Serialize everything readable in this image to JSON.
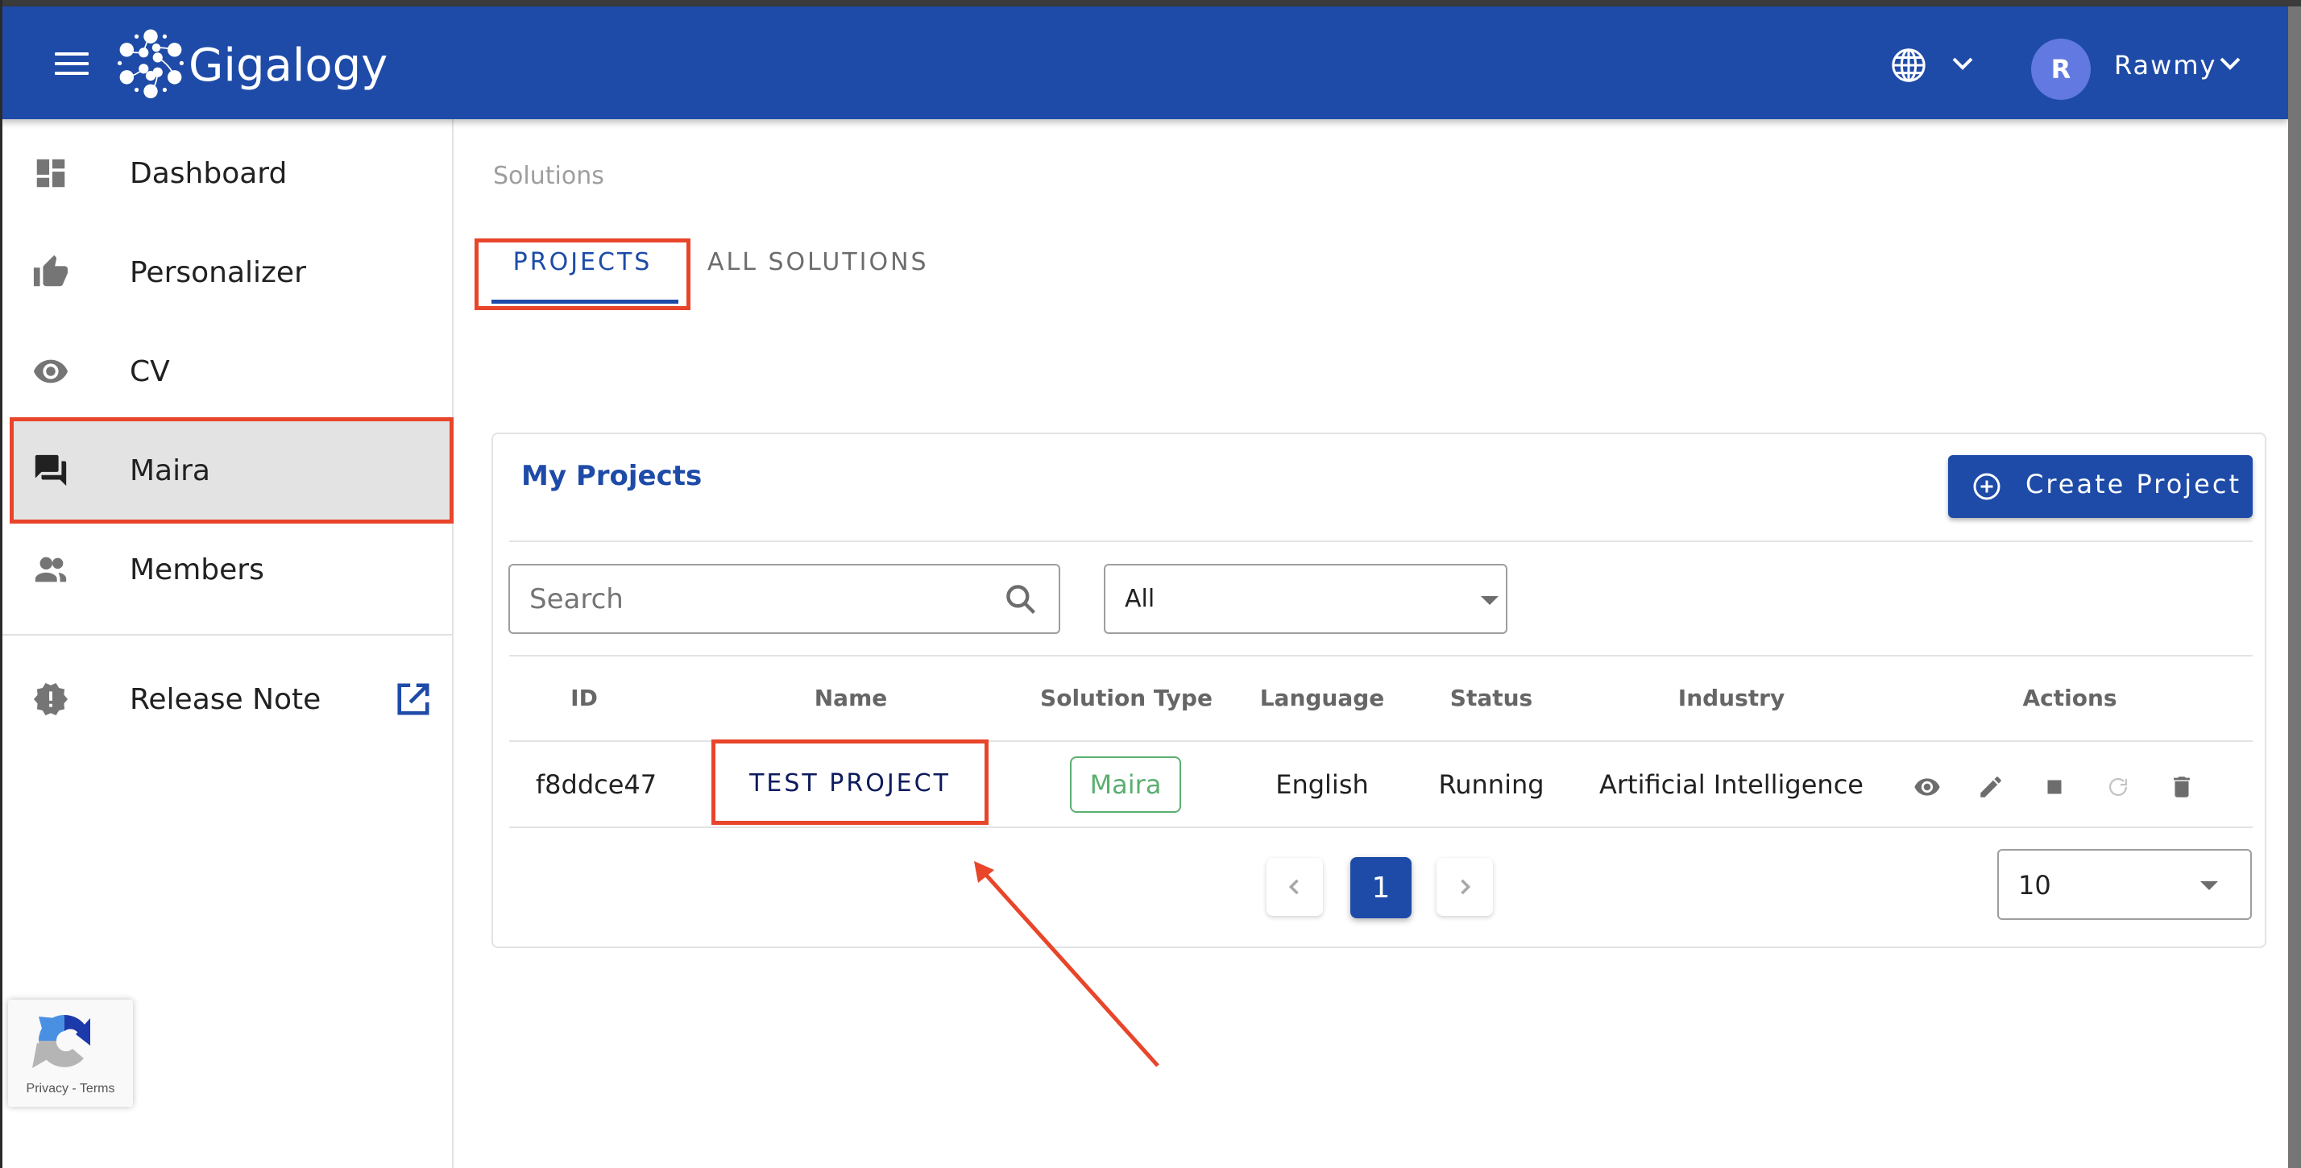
{
  "header": {
    "brand": "Gigalogy",
    "avatar_initial": "R",
    "username": "Rawmy",
    "brand_color": "#1e4ba8"
  },
  "sidebar": {
    "items": [
      {
        "label": "Dashboard",
        "icon": "dashboard-icon"
      },
      {
        "label": "Personalizer",
        "icon": "thumb-up-icon"
      },
      {
        "label": "CV",
        "icon": "eye-icon"
      },
      {
        "label": "Maira",
        "icon": "chat-icon",
        "active": true
      },
      {
        "label": "Members",
        "icon": "people-icon"
      }
    ],
    "release_note": {
      "label": "Release Note",
      "icon": "alert-badge-icon",
      "link_icon": "open-in-new-icon"
    }
  },
  "recaptcha": {
    "text": "Privacy - Terms"
  },
  "main": {
    "breadcrumb": "Solutions",
    "tabs": [
      {
        "label": "PROJECTS",
        "active": true
      },
      {
        "label": "ALL SOLUTIONS",
        "active": false
      }
    ],
    "card": {
      "title": "My Projects",
      "create_button": "Create Project",
      "search_placeholder": "Search",
      "filter_value": "All",
      "table": {
        "columns": [
          "ID",
          "Name",
          "Solution Type",
          "Language",
          "Status",
          "Industry",
          "Actions"
        ],
        "rows": [
          {
            "id": "f8ddce47",
            "name": "TEST PROJECT",
            "solution_type": "Maira",
            "language": "English",
            "status": "Running",
            "industry": "Artificial Intelligence",
            "actions": [
              "view-icon",
              "edit-icon",
              "stop-icon",
              "restart-icon",
              "delete-icon"
            ]
          }
        ]
      },
      "pagination": {
        "current_page": "1",
        "rows_per_page": "10"
      }
    }
  },
  "annotation_color": "#e8452a"
}
